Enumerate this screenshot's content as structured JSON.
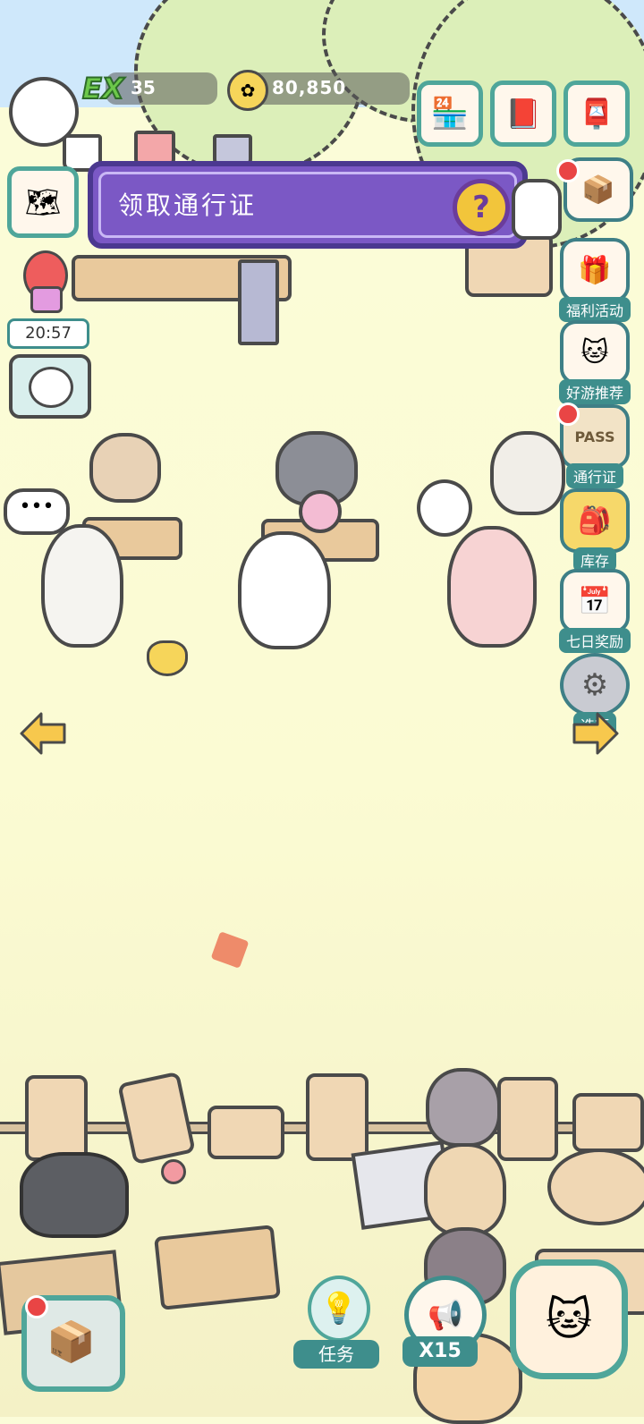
{
  "hud": {
    "level_label": "EX",
    "level_value": "35",
    "coins": "80,850"
  },
  "banner": {
    "text": "领取通行证",
    "help_symbol": "?"
  },
  "left_panel": {
    "timer": "20:57"
  },
  "side_menu": [
    {
      "label": "福利活动",
      "icon": "gift-cat-icon",
      "badge": false
    },
    {
      "label": "好游推荐",
      "icon": "game-box-cat-icon",
      "badge": false
    },
    {
      "label": "通行证",
      "icon": "pass-ticket-icon",
      "badge": true
    },
    {
      "label": "库存",
      "icon": "backpack-icon",
      "badge": false
    },
    {
      "label": "七日奖励",
      "icon": "calendar-icon",
      "badge": false
    },
    {
      "label": "选项",
      "icon": "gear-icon",
      "badge": false
    }
  ],
  "bottom_bar": {
    "tasks_label": "任务",
    "multiplier_label": "X15"
  },
  "colors": {
    "teal": "#3e8e8c",
    "banner_purple": "#7b58c5",
    "help_gold": "#f2c53b",
    "badge_red": "#e94545",
    "ground": "#fbfcd9"
  }
}
